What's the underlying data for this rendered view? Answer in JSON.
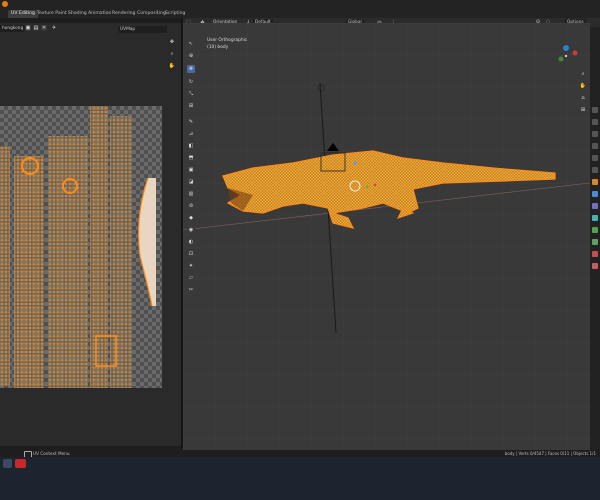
{
  "workspace_tabs": [
    "UV Editing",
    "Texture Paint",
    "Shading",
    "Animation",
    "Rendering",
    "Compositing",
    "Scripting"
  ],
  "uv_editor": {
    "filename": "hongkong",
    "uvmap": "UVMap"
  },
  "viewport": {
    "orientation_label": "Orientation",
    "orientation_value": "Default",
    "mode": "Edit Mode",
    "menus": [
      "View",
      "Select",
      "Add",
      "Mesh",
      "Vertex",
      "Edge",
      "Face",
      "UV"
    ],
    "transform_orientation": "Global",
    "options_label": "Options",
    "view_name": "User Orthographic",
    "object_name": "(10) body"
  },
  "status": {
    "left": "UV Context Menu",
    "right": "body | Verts 0/4547 | Faces 0/11 | Objects 1/1"
  },
  "colors": {
    "selection": "#ff8c1a",
    "active_tab": "#3d3d3d",
    "viewport_bg": "#393939"
  }
}
